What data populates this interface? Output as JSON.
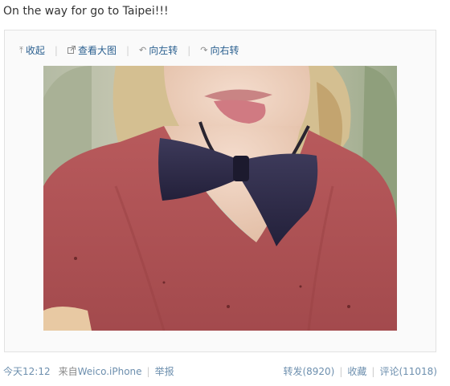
{
  "post": {
    "text": "On the way for go to Taipei!!!"
  },
  "toolbar": {
    "collapse_label": "收起",
    "collapse_icon": "up-arrow-icon",
    "view_large_label": "查看大图",
    "view_large_icon": "external-link-icon",
    "rotate_left_label": "向左转",
    "rotate_left_icon": "rotate-left-icon",
    "rotate_right_label": "向右转",
    "rotate_right_icon": "rotate-right-icon"
  },
  "footer": {
    "time": "今天12:12",
    "source_prefix": "来自",
    "source_link": "Weico.iPhone",
    "report_label": "举报",
    "repost_label": "转发(8920)",
    "favorite_label": "收藏",
    "comment_label": "评论(11018)"
  },
  "colors": {
    "link": "#2a5f8f",
    "muted": "#8a8a8a"
  }
}
